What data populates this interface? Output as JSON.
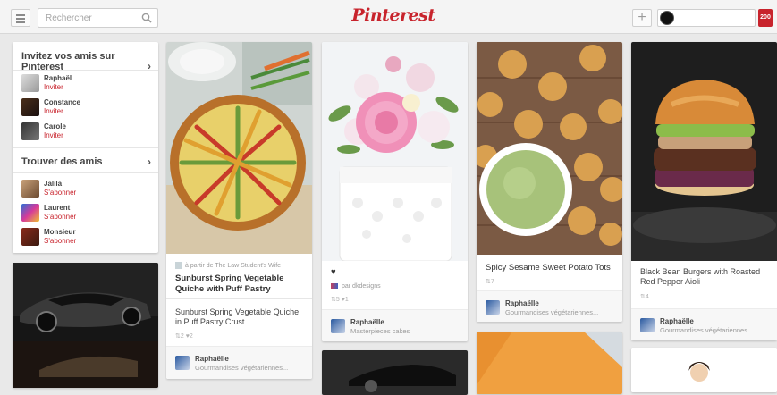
{
  "header": {
    "search_placeholder": "Rechercher",
    "logo": "Pinterest",
    "notifications": "200",
    "brand_color": "#c8232c"
  },
  "sidebar": {
    "invite_title": "Invitez vos amis sur Pinterest",
    "invite_people": [
      {
        "name": "Raphaël",
        "action": "Inviter"
      },
      {
        "name": "Constance",
        "action": "Inviter"
      },
      {
        "name": "Carole",
        "action": "Inviter"
      }
    ],
    "find_title": "Trouver des amis",
    "find_people": [
      {
        "name": "Jalila",
        "action": "S'abonner"
      },
      {
        "name": "Laurent",
        "action": "S'abonner"
      },
      {
        "name": "Monsieur",
        "action": "S'abonner"
      }
    ]
  },
  "pins": [
    {
      "via": "à partir de The Law Student's Wife",
      "title": "Sunburst Spring Vegetable Quiche with Puff Pastry",
      "desc": "Sunburst Spring Vegetable Quiche in Puff Pastry Crust",
      "stats": "⇅2 ♥2",
      "user": "Raphaëlle",
      "board": "Gourmandises végétariennes..."
    },
    {
      "title": "♥",
      "via": "par dkdesigns",
      "stats": "⇅5 ♥1",
      "user": "Raphaëlle",
      "board": "Masterpieces cakes"
    },
    {
      "title": "Spicy Sesame Sweet Potato Tots",
      "stats": "⇅7",
      "user": "Raphaëlle",
      "board": "Gourmandises végétariennes..."
    },
    {
      "title": "Black Bean Burgers with Roasted Red Pepper Aioli",
      "stats": "⇅4",
      "user": "Raphaëlle",
      "board": "Gourmandises végétariennes..."
    }
  ]
}
